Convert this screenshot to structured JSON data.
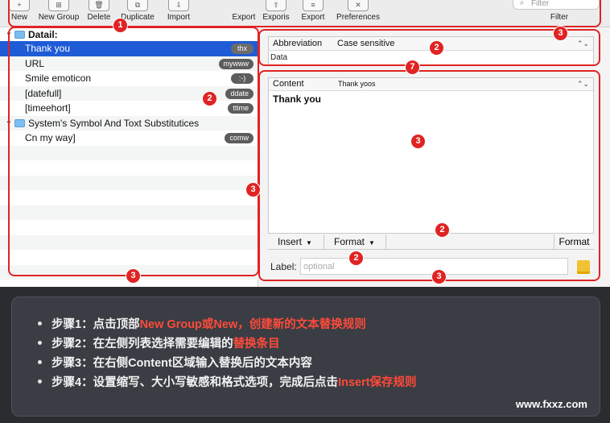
{
  "toolbar": {
    "new": {
      "icon": "+",
      "label": "New"
    },
    "new_group": {
      "icon": "⊞",
      "label": "New Group"
    },
    "delete": {
      "icon": "🗑",
      "label": "Delete"
    },
    "duplicate": {
      "icon": "⧉",
      "label": "Duplicate"
    },
    "import": {
      "icon": "⇩",
      "label": "Import"
    },
    "export1": {
      "icon": "⇧",
      "label": "Export"
    },
    "exports": {
      "icon": "⇧",
      "label": "Exporis"
    },
    "export2": {
      "icon": "≡",
      "label": "Export"
    },
    "preferences": {
      "icon": "✕",
      "label": "Preferences"
    },
    "filter": {
      "placeholder": "Filter",
      "label": "Filter"
    }
  },
  "snippet_list": {
    "group1": "Datail:",
    "items": [
      {
        "label": "Thank you",
        "abbr": "thx"
      },
      {
        "label": "URL",
        "abbr": "mywww"
      },
      {
        "label": "Smile emoticon",
        "abbr": ":-)"
      },
      {
        "label": "[datefull]",
        "abbr": "ddate"
      },
      {
        "label": "[timeehort]",
        "abbr": "ttime"
      }
    ],
    "group2": "System's Symbol And Toxt Substitutices",
    "group2_items": [
      {
        "label": "Cn my way]",
        "abbr": "comw"
      }
    ]
  },
  "editor": {
    "abbreviation_label": "Abbreviation",
    "case_label": "Case sensitive",
    "abbreviation_value": "Data",
    "content_label": "Content",
    "content_format": "Thank yoos",
    "content_text": "Thank you",
    "insert_label": "Insert",
    "format_label": "Format",
    "format_right_label": "Format",
    "label_label": "Label:",
    "label_placeholder": "optional"
  },
  "annotations": {
    "b1": "1",
    "b2a": "2",
    "b2b": "2",
    "b2c": "2",
    "b2d": "2",
    "b3a": "3",
    "b3b": "3",
    "b3c": "3",
    "b3d": "3",
    "b3e": "3",
    "b7": "7"
  },
  "instructions": {
    "step1_pre": "步骤1：点击顶部",
    "step1_hl": "New Group或New，创建新的文本替换规则",
    "step2_pre": "步骤2：在左侧列表选择需要编辑的",
    "step2_hl": "替换条目",
    "step3": "步骤3：在右侧Content区域输入替换后的文本内容",
    "step4_pre": "步骤4：设置缩写、大小写敏感和格式选项，完成后点击",
    "step4_hl": "Insert保存规则",
    "watermark": "www.fxxz.com"
  },
  "colors": {
    "accent_red": "#e02323",
    "selection_blue": "#1f5bd6",
    "highlight_red": "#ff4a3a"
  }
}
